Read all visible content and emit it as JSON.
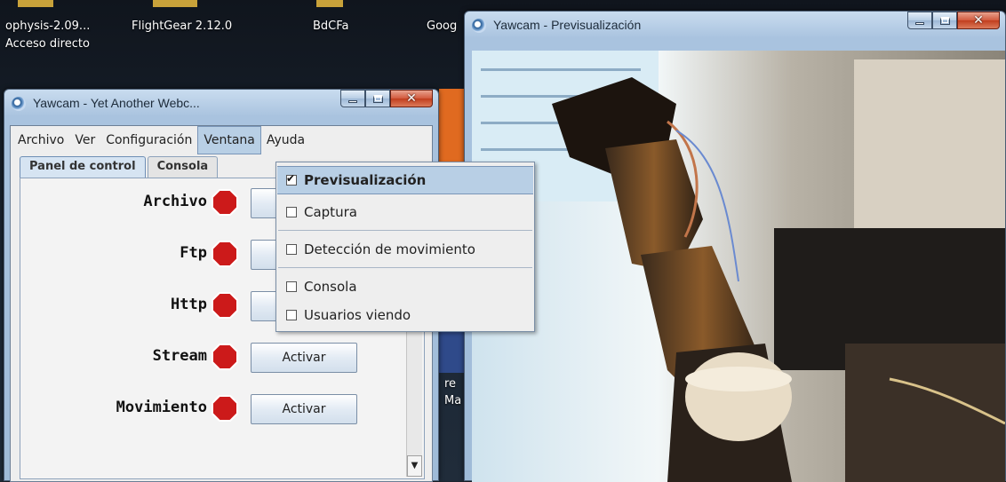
{
  "desktop": {
    "labels": [
      "ophysis-2.09...",
      "FlightGear 2.12.0",
      "BdCFa",
      "Goog",
      "Acceso directo",
      "re",
      "Ma"
    ]
  },
  "control_window": {
    "title": "Yawcam - Yet Another Webc...",
    "menu": [
      "Archivo",
      "Ver",
      "Configuración",
      "Ventana",
      "Ayuda"
    ],
    "active_menu": "Ventana",
    "tabs": [
      "Panel de control",
      "Consola"
    ],
    "selected_tab": "Panel de control",
    "rows": [
      {
        "label": "Archivo",
        "button": ""
      },
      {
        "label": "Ftp",
        "button": ""
      },
      {
        "label": "Http",
        "button": "Activar"
      },
      {
        "label": "Stream",
        "button": "Activar"
      },
      {
        "label": "Movimiento",
        "button": "Activar"
      }
    ],
    "status_color": "#cc1a1a"
  },
  "ventana_menu": {
    "items": [
      {
        "label": "Previsualización",
        "checked": true
      },
      {
        "label": "Captura",
        "checked": false
      },
      {
        "label": "Detección de movimiento",
        "checked": false
      },
      {
        "label": "Consola",
        "checked": false
      },
      {
        "label": "Usuarios viendo",
        "checked": false
      }
    ]
  },
  "preview_window": {
    "title": "Yawcam - Previsualización"
  }
}
